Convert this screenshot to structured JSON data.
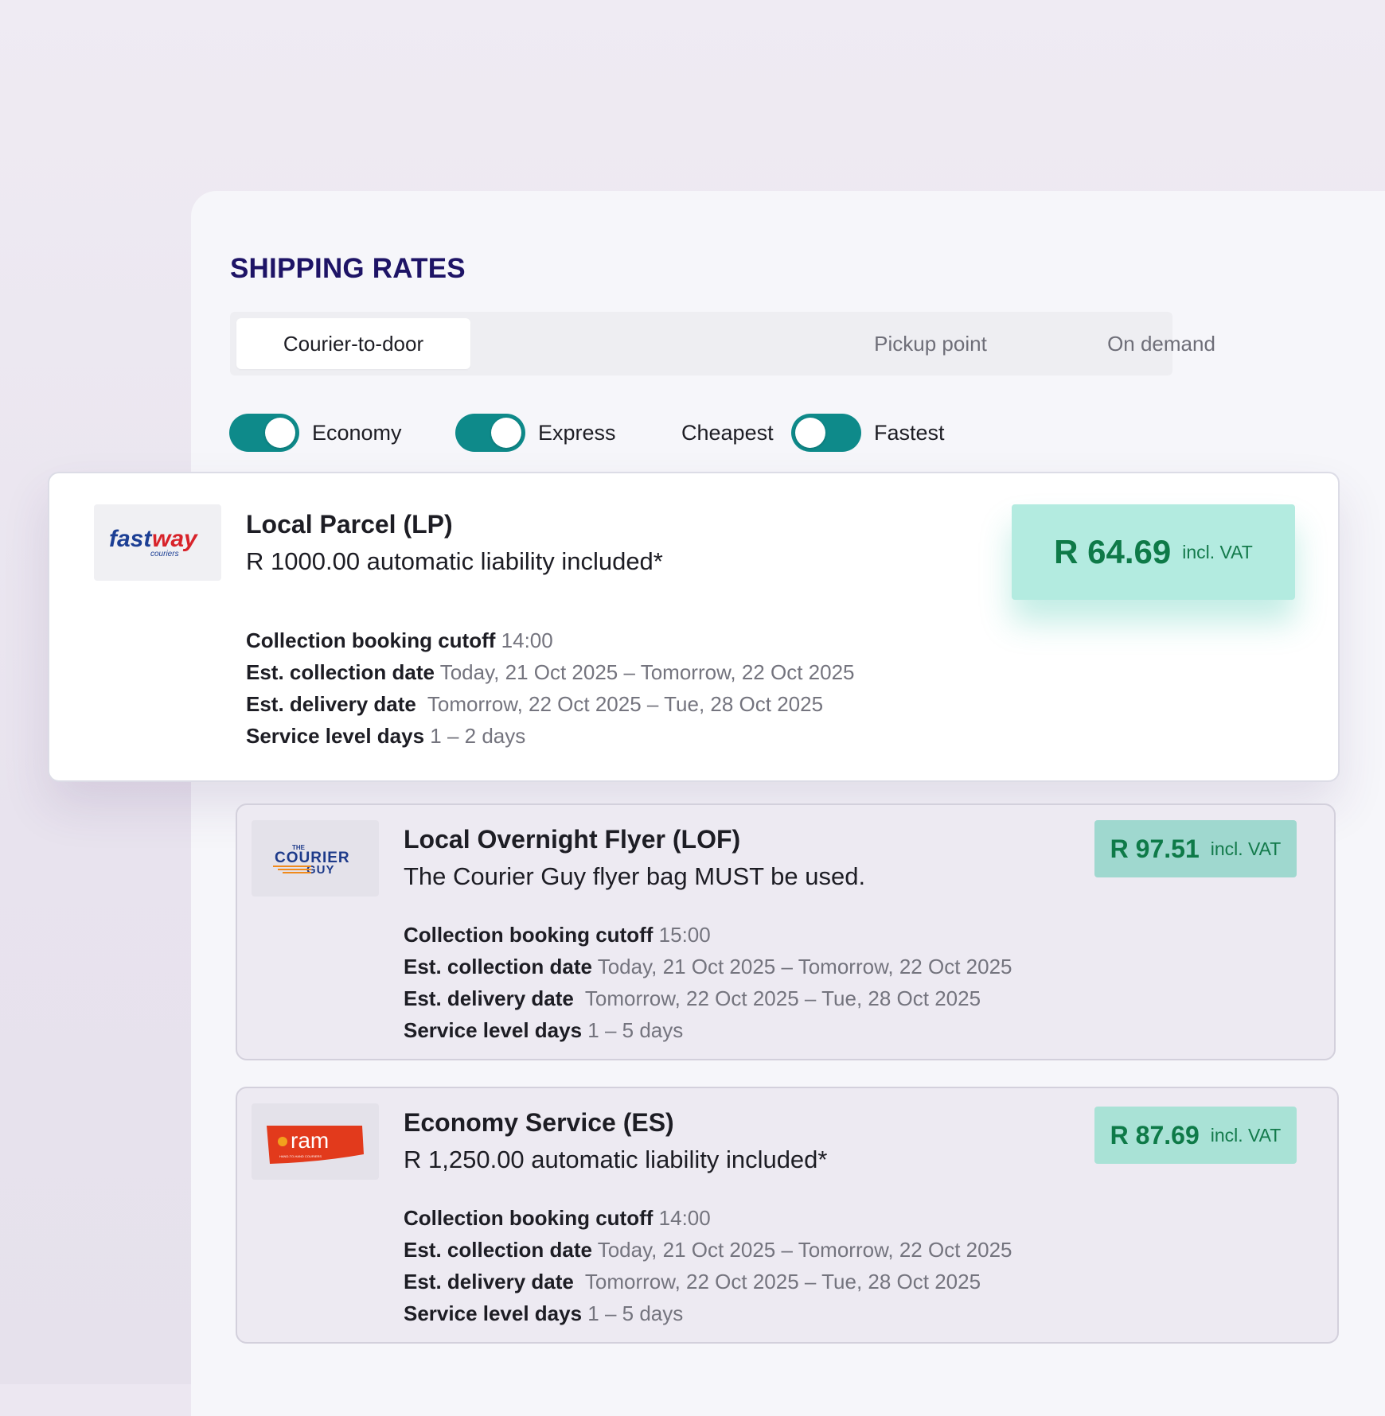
{
  "page_title": "SHIPPING RATES",
  "tabs": [
    {
      "label": "Courier-to-door",
      "active": true
    },
    {
      "label": "Pickup point",
      "active": false
    },
    {
      "label": "On demand",
      "active": false
    }
  ],
  "filters": {
    "economy": {
      "label": "Economy",
      "on": true
    },
    "express": {
      "label": "Express",
      "on": true
    },
    "sort": {
      "left_label": "Cheapest",
      "right_label": "Fastest"
    }
  },
  "detail_labels": {
    "cutoff": "Collection booking cutoff",
    "collection": "Est. collection date",
    "delivery": "Est. delivery date",
    "service_days": "Service level days"
  },
  "rates": [
    {
      "courier": "fastway couriers",
      "logo_text": "fastway",
      "logo_sub": "couriers",
      "service": "Local Parcel (LP)",
      "note": "R 1000.00 automatic liability included*",
      "price": "R 64.69",
      "vat": "incl. VAT",
      "cutoff": "14:00",
      "collection": "Today, 21 Oct 2025 – Tomorrow, 22 Oct 2025",
      "delivery": "Tomorrow, 22 Oct 2025 – Tue, 28 Oct 2025",
      "service_days": "1 – 2 days"
    },
    {
      "courier": "The Courier Guy",
      "logo_text": "COURIER",
      "logo_sub": "GUY",
      "logo_top": "THE",
      "service": "Local Overnight Flyer (LOF)",
      "note": "The Courier Guy flyer bag MUST be used.",
      "price": "R 97.51",
      "vat": "incl. VAT",
      "cutoff": "15:00",
      "collection": "Today, 21 Oct 2025 – Tomorrow, 22 Oct 2025",
      "delivery": "Tomorrow, 22 Oct 2025 – Tue, 28 Oct 2025",
      "service_days": "1 – 5 days"
    },
    {
      "courier": "RAM Hand-to-Hand Couriers",
      "logo_text": "ram",
      "logo_sub": "HAND-TO-HAND COURIERS",
      "service": "Economy Service (ES)",
      "note": "R 1,250.00 automatic liability included*",
      "price": "R 87.69",
      "vat": "incl. VAT",
      "cutoff": "14:00",
      "collection": "Today, 21 Oct 2025 – Tomorrow, 22 Oct 2025",
      "delivery": "Tomorrow, 22 Oct 2025 – Tue, 28 Oct 2025",
      "service_days": "1 – 5 days"
    }
  ],
  "colors": {
    "title": "#1e1466",
    "toggle_on": "#0e8a8a",
    "price_bg_featured": "#b3ebe0",
    "price_bg": "#9fd8cf",
    "price_text": "#0e7a48",
    "fastway_red": "#d8232a",
    "fastway_blue": "#1c3f94",
    "courierguy_blue": "#1d3a8a",
    "courierguy_orange": "#f08a1c",
    "ram_red": "#e23a1c"
  }
}
